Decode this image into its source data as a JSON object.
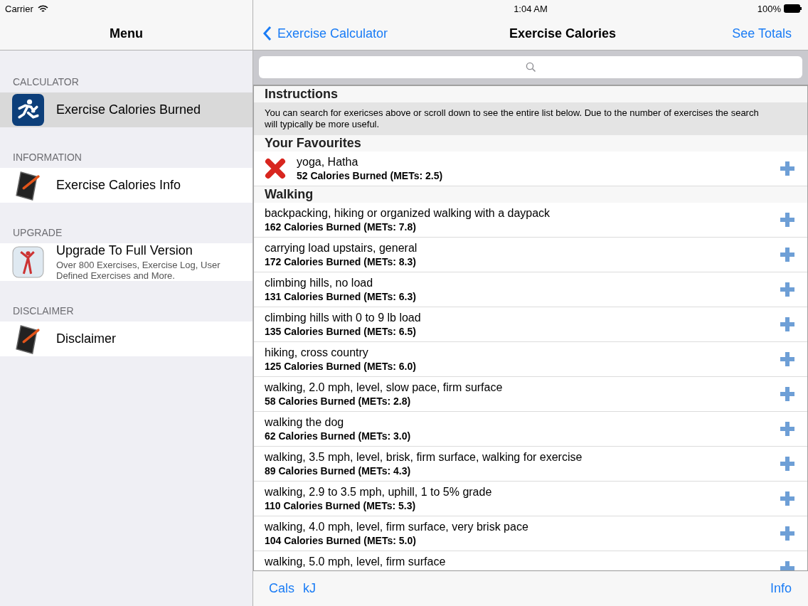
{
  "status_bar": {
    "carrier": "Carrier",
    "time": "1:04 AM",
    "battery": "100%"
  },
  "menu": {
    "title": "Menu",
    "sections": [
      {
        "header": "CALCULATOR",
        "items": [
          {
            "kind": "runner",
            "label": "Exercise Calories Burned",
            "selected": true
          }
        ]
      },
      {
        "header": "INFORMATION",
        "items": [
          {
            "kind": "notebook",
            "label": "Exercise Calories Info",
            "selected": false
          }
        ]
      },
      {
        "header": "UPGRADE",
        "items": [
          {
            "kind": "figure",
            "label": "Upgrade To Full Version",
            "subtitle": "Over 800 Exercises, Exercise Log, User Defined Exercises and More.",
            "selected": false
          }
        ]
      },
      {
        "header": "DISCLAIMER",
        "items": [
          {
            "kind": "notebook",
            "label": "Disclaimer",
            "selected": false
          }
        ]
      }
    ]
  },
  "nav": {
    "back": "Exercise Calculator",
    "title": "Exercise Calories",
    "action": "See Totals"
  },
  "list": {
    "sections": [
      {
        "header": "Instructions",
        "kind": "note",
        "text": "You can search for exericses above or scroll down to see the entire list below.  Due to the number of exercises the search will typically be more useful."
      },
      {
        "header": "Your Favourites",
        "kind": "rows",
        "removable": true,
        "rows": [
          {
            "name": "yoga, Hatha",
            "calories": "52 Calories Burned  (METs: 2.5)"
          }
        ]
      },
      {
        "header": "Walking",
        "kind": "rows",
        "removable": false,
        "rows": [
          {
            "name": "backpacking, hiking or organized walking with a daypack",
            "calories": "162 Calories Burned  (METs: 7.8)"
          },
          {
            "name": "carrying load upstairs, general",
            "calories": "172 Calories Burned  (METs: 8.3)"
          },
          {
            "name": "climbing hills, no load",
            "calories": "131 Calories Burned  (METs: 6.3)"
          },
          {
            "name": "climbing hills with 0 to 9 lb load",
            "calories": "135 Calories Burned  (METs: 6.5)"
          },
          {
            "name": "hiking, cross country",
            "calories": "125 Calories Burned  (METs: 6.0)"
          },
          {
            "name": "walking, 2.0 mph, level, slow pace, firm surface",
            "calories": "58 Calories Burned  (METs: 2.8)"
          },
          {
            "name": "walking the dog",
            "calories": "62 Calories Burned  (METs: 3.0)"
          },
          {
            "name": "walking, 3.5 mph, level, brisk, firm surface, walking for exercise",
            "calories": "89 Calories Burned  (METs: 4.3)"
          },
          {
            "name": "walking, 2.9 to 3.5 mph, uphill, 1 to 5% grade",
            "calories": "110 Calories Burned  (METs: 5.3)"
          },
          {
            "name": "walking, 4.0 mph, level, firm surface, very brisk pace",
            "calories": "104 Calories Burned  (METs: 5.0)"
          },
          {
            "name": "walking, 5.0 mph, level, firm surface"
          }
        ]
      }
    ]
  },
  "toolbar": {
    "left": [
      "Cals",
      "kJ"
    ],
    "right": "Info"
  }
}
